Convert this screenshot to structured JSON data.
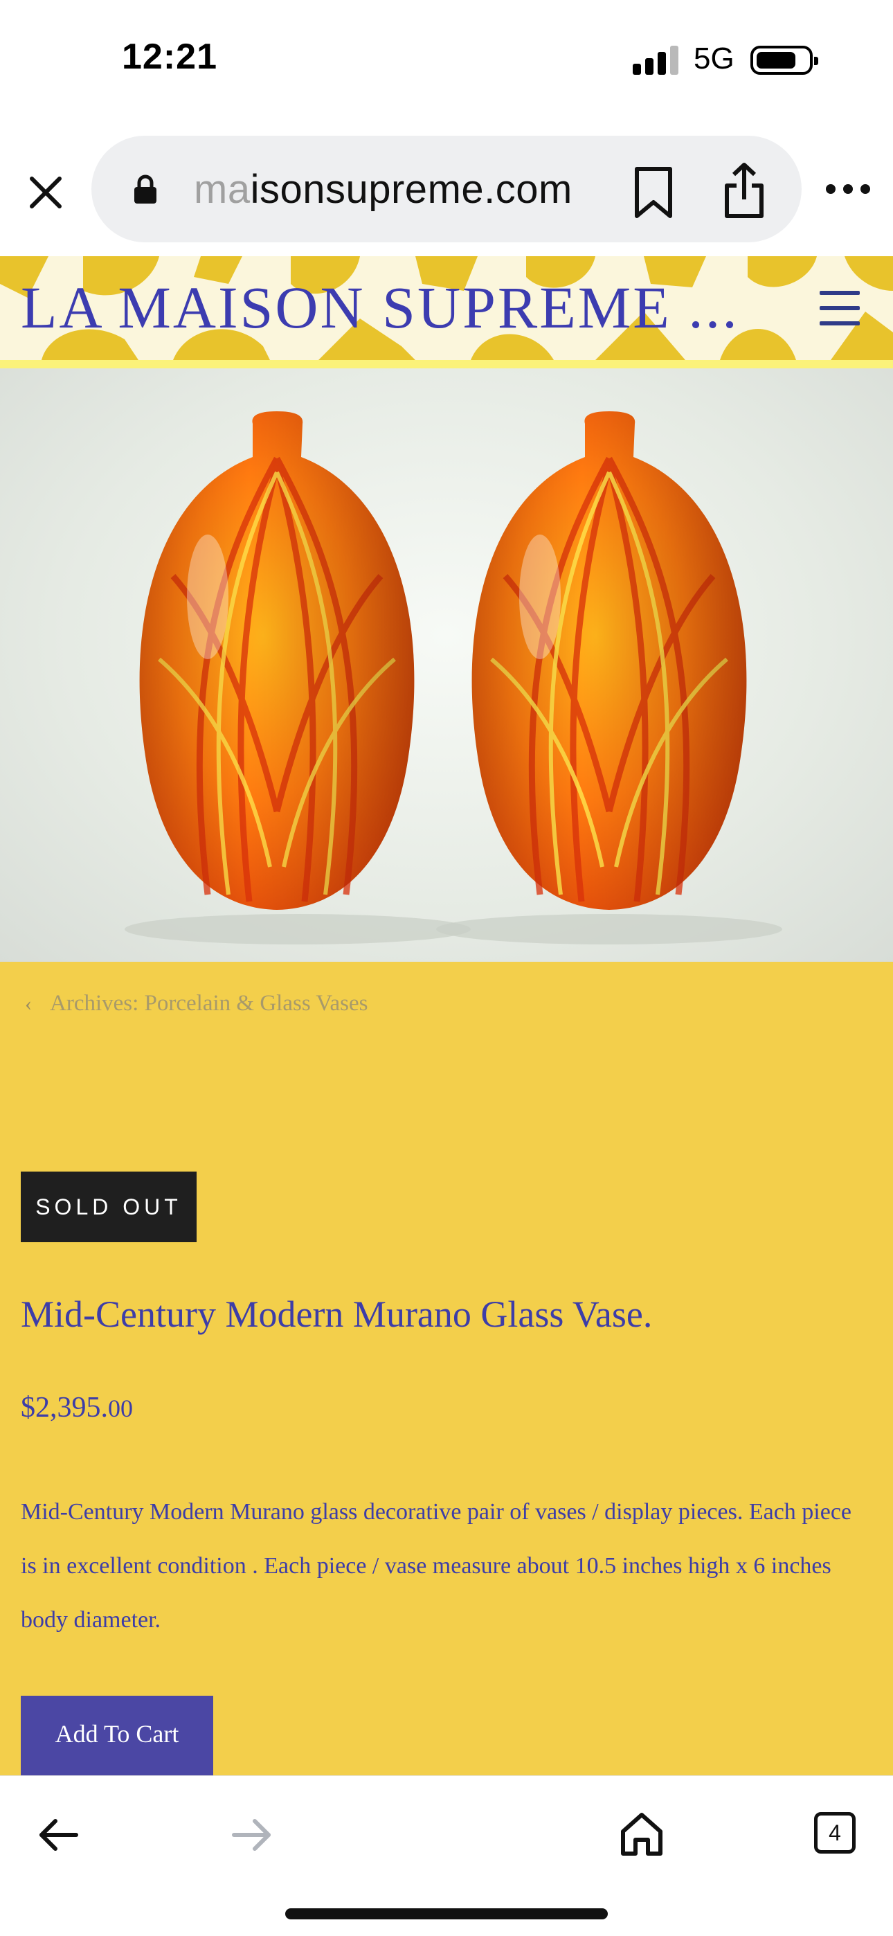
{
  "status_bar": {
    "time": "12:21",
    "network": "5G",
    "signal_icon": "cellular-signal-icon",
    "battery_icon": "battery-icon"
  },
  "browser": {
    "url_faded_prefix": "ma",
    "url_rest": "isonsupreme.com",
    "icons": [
      "close-icon",
      "lock-icon",
      "bookmark-icon",
      "share-icon",
      "more-icon"
    ]
  },
  "site": {
    "title": "LA MAISON SUPREME ...",
    "menu_icon": "hamburger-menu-icon"
  },
  "product": {
    "image_alt": "pair of orange Murano glass vases",
    "breadcrumb": "Archives: Porcelain & Glass Vases",
    "badge": "SOLD OUT",
    "title": "Mid-Century Modern Murano Glass Vase.",
    "price_main": "$2,395.",
    "price_cents": "00",
    "description": "Mid-Century Modern Murano glass decorative pair of vases / display pieces. Each piece is in excellent condition . Each piece / vase measure about 10.5 inches high x 6 inches body diameter.",
    "add_to_cart": "Add To Cart"
  },
  "toolbar": {
    "tabs_count": "4",
    "icons": [
      "back-arrow-icon",
      "forward-arrow-icon",
      "home-icon",
      "tabs-icon"
    ]
  },
  "colors": {
    "content_bg": "#f3cf4b",
    "brand_blue": "#3d3da8",
    "button_bg": "#4b47a4",
    "badge_bg": "#1f1f1f",
    "header_pattern": "#e8c32c"
  }
}
